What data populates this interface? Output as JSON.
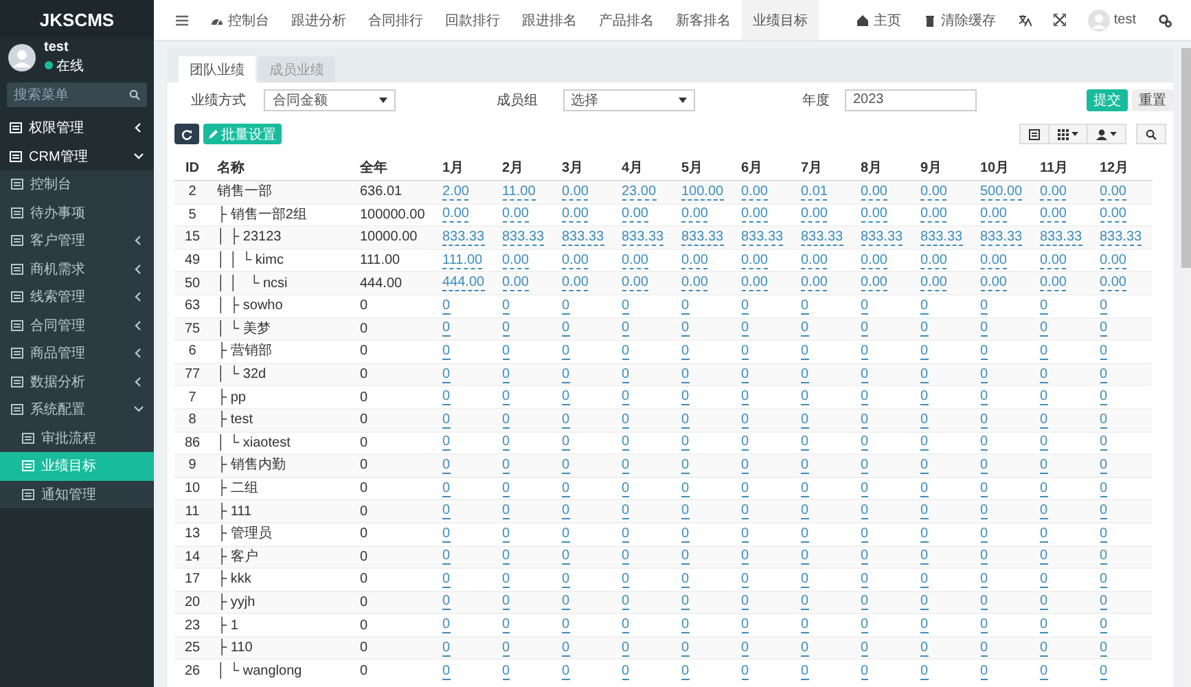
{
  "sidebar": {
    "logo": "JKSCMS",
    "user": {
      "name": "test",
      "status": "在线"
    },
    "search": {
      "placeholder": "搜索菜单"
    },
    "items": [
      {
        "label": "权限管理",
        "expanded": false,
        "selected": false
      },
      {
        "label": "CRM管理",
        "expanded": true,
        "selected": false,
        "children": [
          {
            "label": "控制台",
            "selected": false
          },
          {
            "label": "待办事项",
            "selected": false
          },
          {
            "label": "客户管理",
            "expanded": false,
            "selected": false
          },
          {
            "label": "商机需求",
            "expanded": false,
            "selected": false
          },
          {
            "label": "线索管理",
            "expanded": false,
            "selected": false
          },
          {
            "label": "合同管理",
            "expanded": false,
            "selected": false
          },
          {
            "label": "商品管理",
            "expanded": false,
            "selected": false
          },
          {
            "label": "数据分析",
            "expanded": false,
            "selected": false
          },
          {
            "label": "系统配置",
            "expanded": true,
            "selected": false,
            "children": [
              {
                "label": "审批流程",
                "selected": false
              },
              {
                "label": "业绩目标",
                "selected": true
              },
              {
                "label": "通知管理",
                "selected": false
              }
            ]
          }
        ]
      }
    ]
  },
  "topbar": {
    "nav": [
      {
        "label": "控制台",
        "selected": false
      },
      {
        "label": "跟进分析",
        "selected": false
      },
      {
        "label": "合同排行",
        "selected": false
      },
      {
        "label": "回款排行",
        "selected": false
      },
      {
        "label": "跟进排名",
        "selected": false
      },
      {
        "label": "产品排名",
        "selected": false
      },
      {
        "label": "新客排名",
        "selected": false
      },
      {
        "label": "业绩目标",
        "selected": true
      }
    ],
    "links": [
      "主页",
      "清除缓存"
    ],
    "user": "test"
  },
  "tabs": [
    {
      "label": "团队业绩",
      "selected": true
    },
    {
      "label": "成员业绩",
      "selected": false
    }
  ],
  "filters": [
    {
      "label": "业绩方式",
      "kind": "select",
      "value": "合同金额"
    },
    {
      "label": "成员组",
      "kind": "select",
      "value": "选择"
    },
    {
      "label": "年度",
      "kind": "input",
      "value": "2023"
    }
  ],
  "form_buttons": [
    {
      "label": "提交",
      "kind": "primary"
    },
    {
      "label": "重置",
      "kind": "default"
    }
  ],
  "toolbar": {
    "batch_button": "批量设置"
  },
  "table": {
    "columns": [
      "ID",
      "名称",
      "全年",
      "1月",
      "2月",
      "3月",
      "4月",
      "5月",
      "6月",
      "7月",
      "8月",
      "9月",
      "10月",
      "11月",
      "12月"
    ],
    "rows": [
      {
        "id": "2",
        "name": "销售一部",
        "year": "636.01",
        "months": [
          "2.00",
          "11.00",
          "0.00",
          "23.00",
          "100.00",
          "0.00",
          "0.01",
          "0.00",
          "0.00",
          "500.00",
          "0.00",
          "0.00"
        ]
      },
      {
        "id": "5",
        "name": "├ 销售一部2组",
        "year": "100000.00",
        "months": [
          "0.00",
          "0.00",
          "0.00",
          "0.00",
          "0.00",
          "0.00",
          "0.00",
          "0.00",
          "0.00",
          "0.00",
          "0.00",
          "0.00"
        ]
      },
      {
        "id": "15",
        "name": "│ ├ 23123",
        "year": "10000.00",
        "months": [
          "833.33",
          "833.33",
          "833.33",
          "833.33",
          "833.33",
          "833.33",
          "833.33",
          "833.33",
          "833.33",
          "833.33",
          "833.33",
          "833.33"
        ]
      },
      {
        "id": "49",
        "name": "│ │ └ kimc",
        "year": "111.00",
        "months": [
          "111.00",
          "0.00",
          "0.00",
          "0.00",
          "0.00",
          "0.00",
          "0.00",
          "0.00",
          "0.00",
          "0.00",
          "0.00",
          "0.00"
        ]
      },
      {
        "id": "50",
        "name": "│ │   └ ncsi",
        "year": "444.00",
        "months": [
          "444.00",
          "0.00",
          "0.00",
          "0.00",
          "0.00",
          "0.00",
          "0.00",
          "0.00",
          "0.00",
          "0.00",
          "0.00",
          "0.00"
        ]
      },
      {
        "id": "63",
        "name": "│ ├ sowho",
        "year": "0",
        "months": [
          "0",
          "0",
          "0",
          "0",
          "0",
          "0",
          "0",
          "0",
          "0",
          "0",
          "0",
          "0"
        ]
      },
      {
        "id": "75",
        "name": "│ └ 美梦",
        "year": "0",
        "months": [
          "0",
          "0",
          "0",
          "0",
          "0",
          "0",
          "0",
          "0",
          "0",
          "0",
          "0",
          "0"
        ]
      },
      {
        "id": "6",
        "name": "├ 营销部",
        "year": "0",
        "months": [
          "0",
          "0",
          "0",
          "0",
          "0",
          "0",
          "0",
          "0",
          "0",
          "0",
          "0",
          "0"
        ]
      },
      {
        "id": "77",
        "name": "│ └ 32d",
        "year": "0",
        "months": [
          "0",
          "0",
          "0",
          "0",
          "0",
          "0",
          "0",
          "0",
          "0",
          "0",
          "0",
          "0"
        ]
      },
      {
        "id": "7",
        "name": "├ pp",
        "year": "0",
        "months": [
          "0",
          "0",
          "0",
          "0",
          "0",
          "0",
          "0",
          "0",
          "0",
          "0",
          "0",
          "0"
        ]
      },
      {
        "id": "8",
        "name": "├ test",
        "year": "0",
        "months": [
          "0",
          "0",
          "0",
          "0",
          "0",
          "0",
          "0",
          "0",
          "0",
          "0",
          "0",
          "0"
        ]
      },
      {
        "id": "86",
        "name": "│ └ xiaotest",
        "year": "0",
        "months": [
          "0",
          "0",
          "0",
          "0",
          "0",
          "0",
          "0",
          "0",
          "0",
          "0",
          "0",
          "0"
        ]
      },
      {
        "id": "9",
        "name": "├ 销售内勤",
        "year": "0",
        "months": [
          "0",
          "0",
          "0",
          "0",
          "0",
          "0",
          "0",
          "0",
          "0",
          "0",
          "0",
          "0"
        ]
      },
      {
        "id": "10",
        "name": "├ 二组",
        "year": "0",
        "months": [
          "0",
          "0",
          "0",
          "0",
          "0",
          "0",
          "0",
          "0",
          "0",
          "0",
          "0",
          "0"
        ]
      },
      {
        "id": "11",
        "name": "├ 111",
        "year": "0",
        "months": [
          "0",
          "0",
          "0",
          "0",
          "0",
          "0",
          "0",
          "0",
          "0",
          "0",
          "0",
          "0"
        ]
      },
      {
        "id": "13",
        "name": "├ 管理员",
        "year": "0",
        "months": [
          "0",
          "0",
          "0",
          "0",
          "0",
          "0",
          "0",
          "0",
          "0",
          "0",
          "0",
          "0"
        ]
      },
      {
        "id": "14",
        "name": "├ 客户",
        "year": "0",
        "months": [
          "0",
          "0",
          "0",
          "0",
          "0",
          "0",
          "0",
          "0",
          "0",
          "0",
          "0",
          "0"
        ]
      },
      {
        "id": "17",
        "name": "├ kkk",
        "year": "0",
        "months": [
          "0",
          "0",
          "0",
          "0",
          "0",
          "0",
          "0",
          "0",
          "0",
          "0",
          "0",
          "0"
        ]
      },
      {
        "id": "20",
        "name": "├ yyjh",
        "year": "0",
        "months": [
          "0",
          "0",
          "0",
          "0",
          "0",
          "0",
          "0",
          "0",
          "0",
          "0",
          "0",
          "0"
        ]
      },
      {
        "id": "23",
        "name": "├ 1",
        "year": "0",
        "months": [
          "0",
          "0",
          "0",
          "0",
          "0",
          "0",
          "0",
          "0",
          "0",
          "0",
          "0",
          "0"
        ]
      },
      {
        "id": "25",
        "name": "├ 110",
        "year": "0",
        "months": [
          "0",
          "0",
          "0",
          "0",
          "0",
          "0",
          "0",
          "0",
          "0",
          "0",
          "0",
          "0"
        ]
      },
      {
        "id": "26",
        "name": "│ └ wanglong",
        "year": "0",
        "months": [
          "0",
          "0",
          "0",
          "0",
          "0",
          "0",
          "0",
          "0",
          "0",
          "0",
          "0",
          "0"
        ]
      }
    ]
  }
}
